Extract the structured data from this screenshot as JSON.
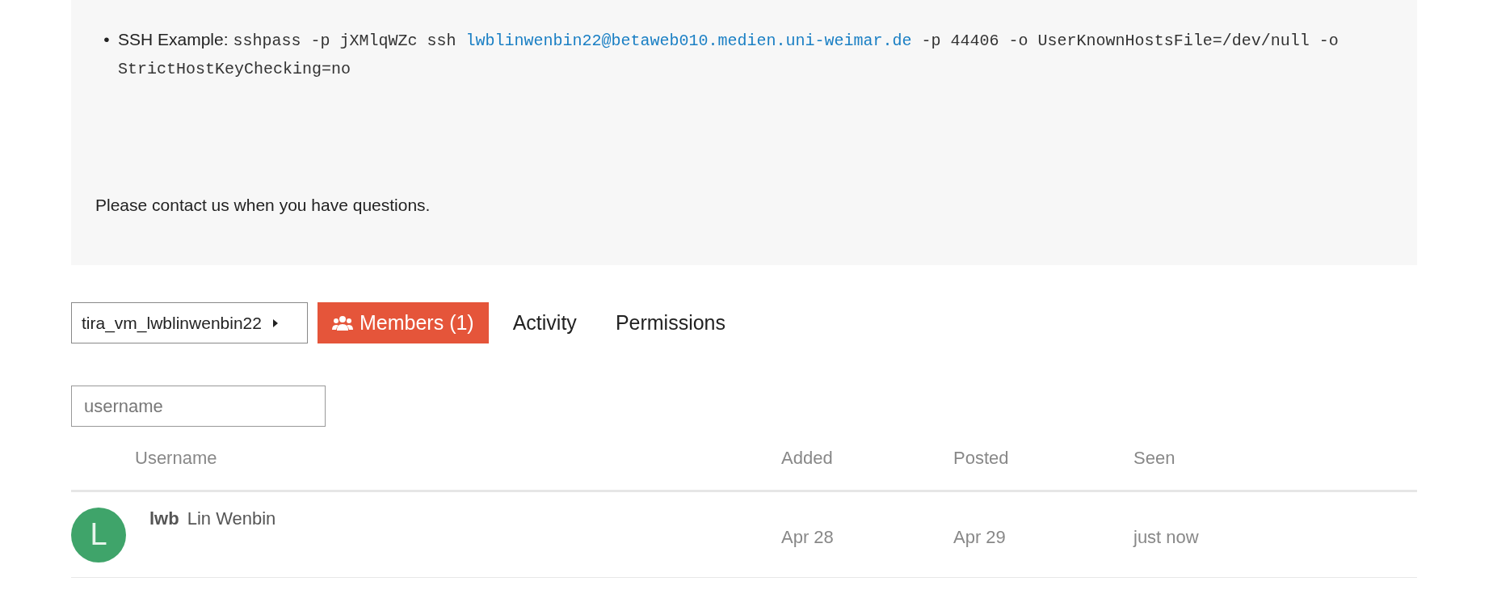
{
  "instructions": {
    "ssh_example": {
      "bullet": "•",
      "label": "SSH Example:",
      "command_before": "sshpass -p jXMlqWZc ssh",
      "link": "lwblinwenbin22@betaweb010.medien.uni-weimar.de",
      "command_after": "-p 44406 -o UserKnownHostsFile=/dev/null -o StrictHostKeyChecking=no"
    },
    "contact_note": "Please contact us when you have questions."
  },
  "vm_selector": {
    "label": "tira_vm_lwblinwenbin22"
  },
  "tabs": [
    {
      "label": "Members (1)",
      "kind": "icon",
      "selected": true
    },
    {
      "label": "Activity",
      "kind": "plain",
      "selected": false
    },
    {
      "label": "Permissions",
      "kind": "plain",
      "selected": false
    }
  ],
  "search": {
    "placeholder": "username"
  },
  "table": {
    "columns": [
      "Username",
      "Added",
      "Posted",
      "Seen"
    ],
    "rows": [
      {
        "avatar_letter": "L",
        "color": "#3fa46a",
        "username": "lwb",
        "name": "Lin Wenbin",
        "added": "Apr 28",
        "posted": "Apr 29",
        "seen": "just now"
      }
    ]
  }
}
